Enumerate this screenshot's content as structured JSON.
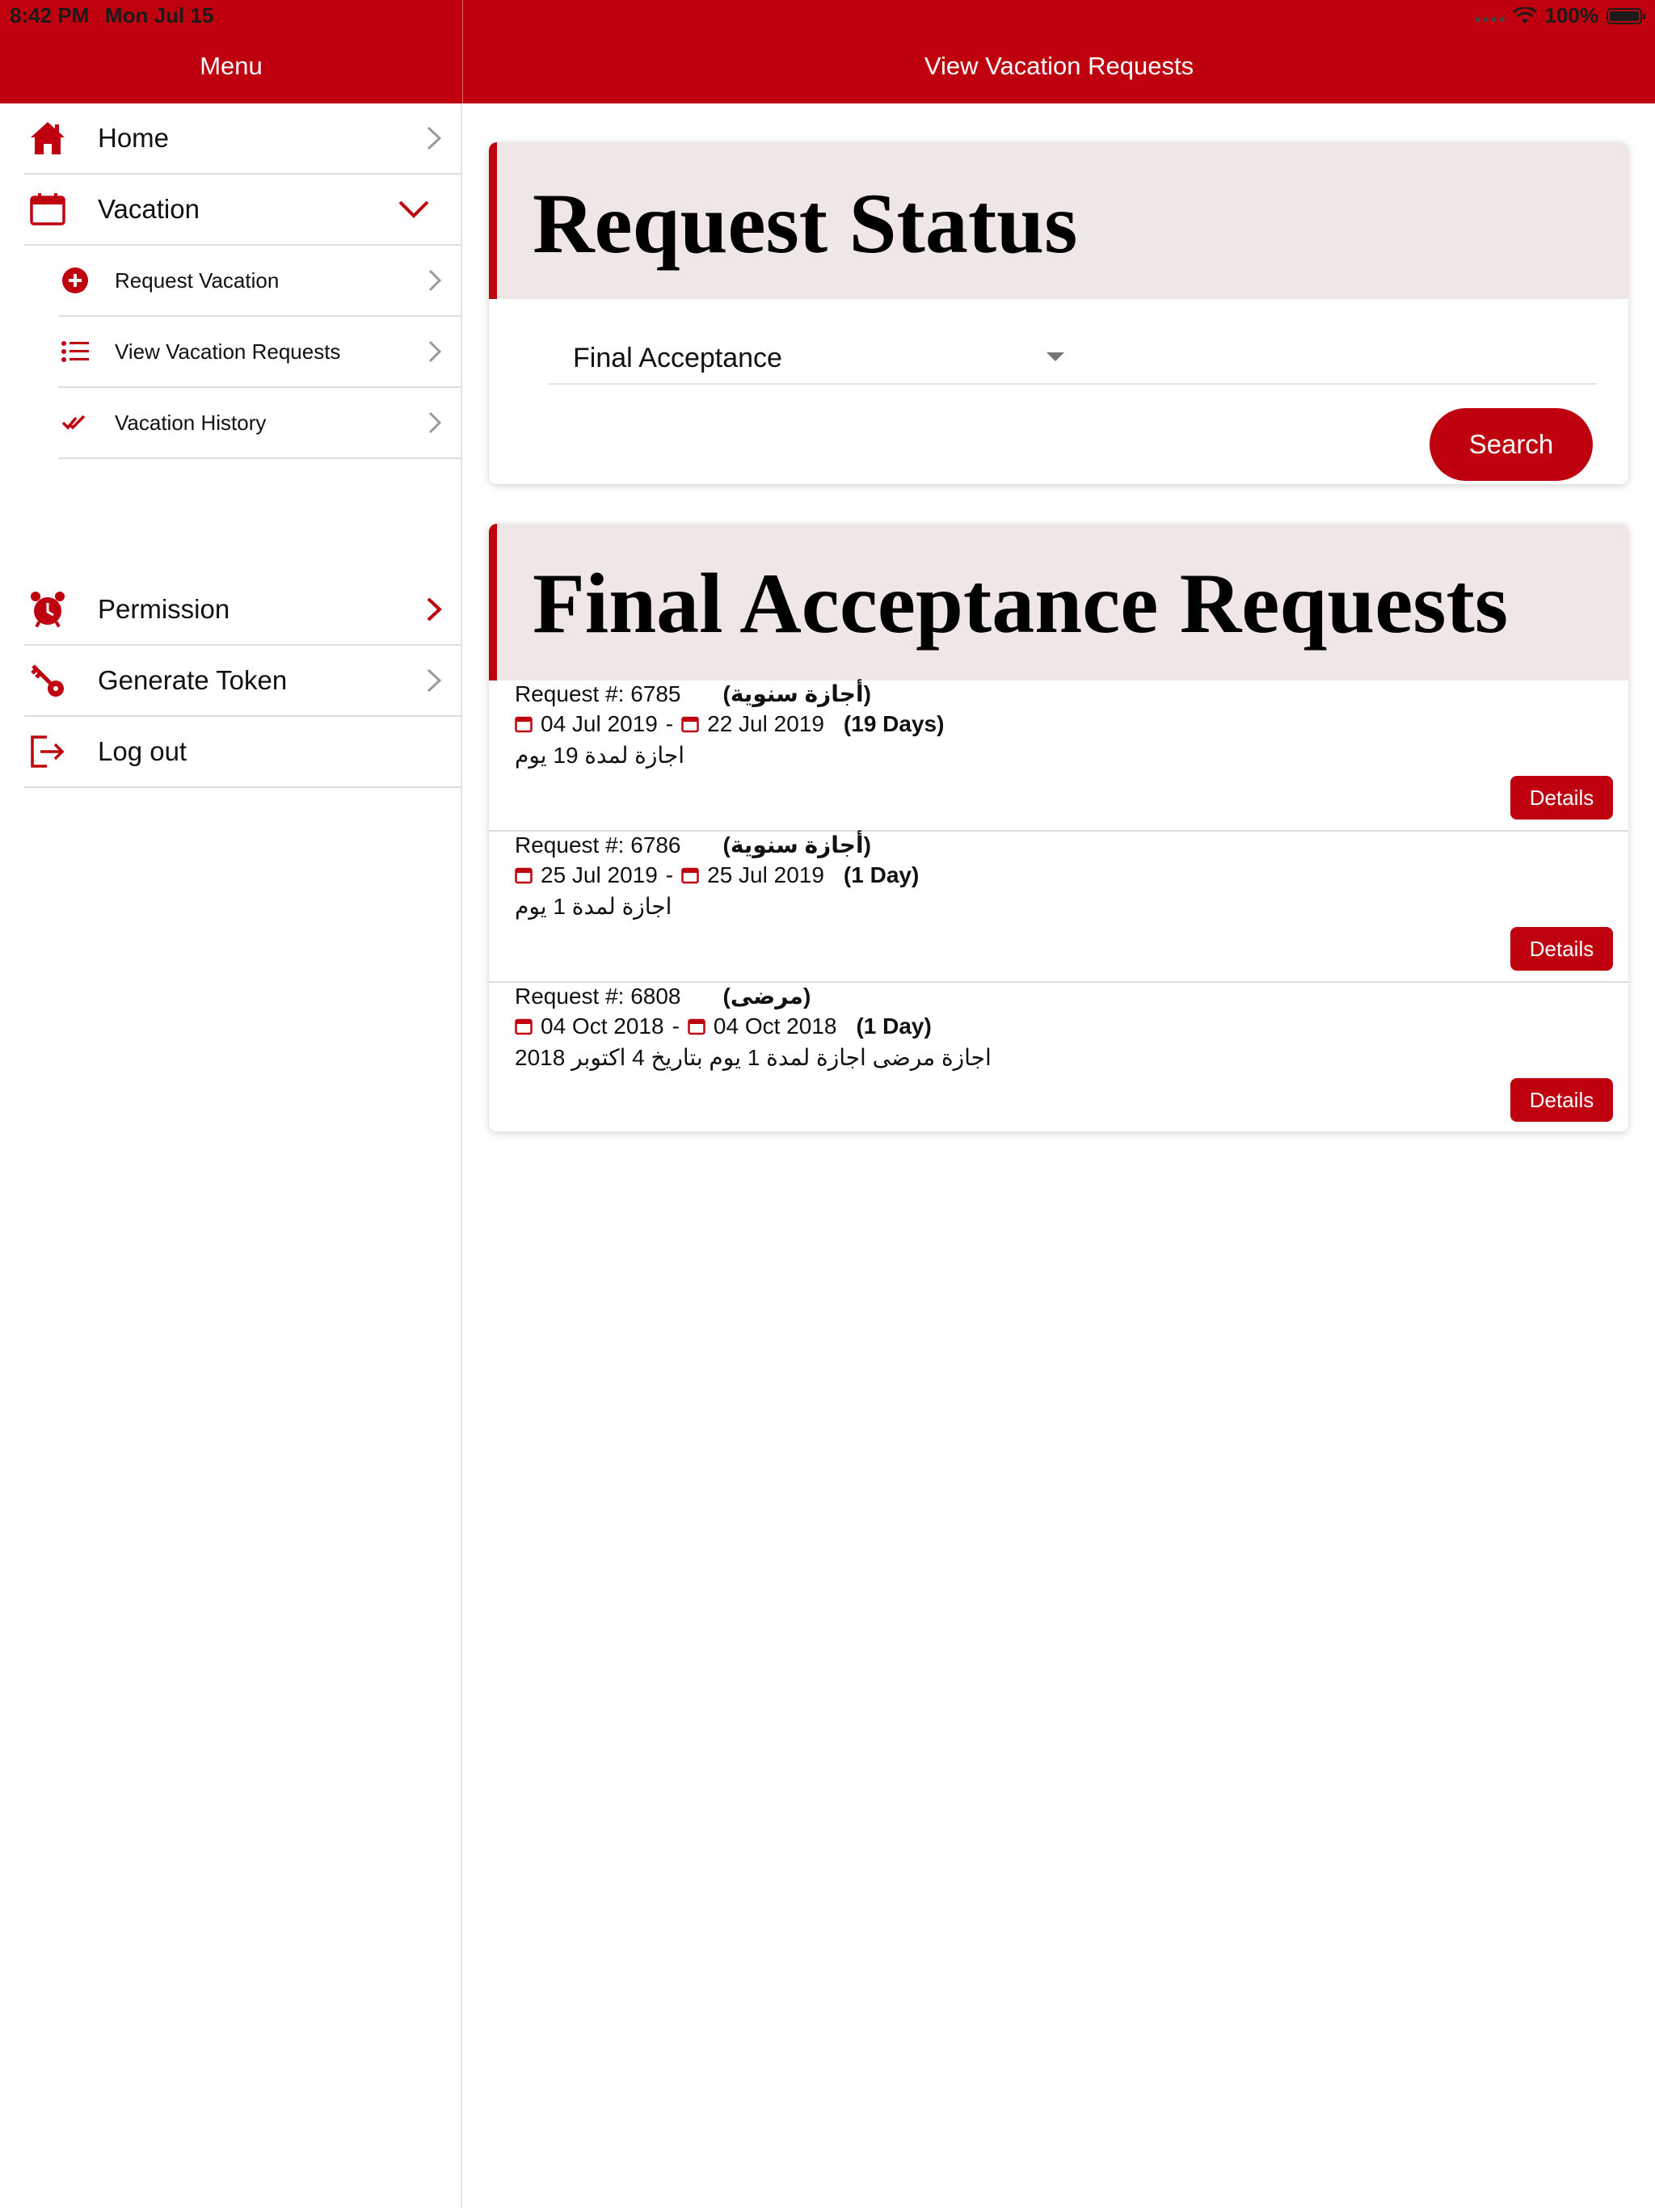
{
  "status_bar": {
    "time": "8:42 PM",
    "date": "Mon Jul 15",
    "battery": "100%"
  },
  "header": {
    "menu_title": "Menu",
    "page_title": "View Vacation Requests"
  },
  "colors": {
    "accent": "#bf000e",
    "card_header_bg": "#efe7e6"
  },
  "sidebar": {
    "items": [
      {
        "label": "Home",
        "icon": "home-icon"
      },
      {
        "label": "Vacation",
        "icon": "calendar-icon",
        "expanded": true,
        "children": [
          {
            "label": "Request Vacation",
            "icon": "plus-circle-icon"
          },
          {
            "label": "View Vacation Requests",
            "icon": "list-icon"
          },
          {
            "label": "Vacation History",
            "icon": "double-check-icon"
          }
        ]
      },
      {
        "label": "Permission",
        "icon": "alarm-clock-icon"
      },
      {
        "label": "Generate Token",
        "icon": "key-icon"
      },
      {
        "label": "Log out",
        "icon": "logout-icon"
      }
    ]
  },
  "status_card": {
    "title": "Request Status",
    "selected_status": "Final Acceptance",
    "search_label": "Search"
  },
  "requests_card": {
    "title": "Final Acceptance Requests",
    "details_label": "Details",
    "requests": [
      {
        "number": "Request #: 6785",
        "type": "(أجازة سنوية)",
        "start": "04 Jul 2019",
        "end": "22 Jul 2019",
        "duration": "(19 Days)",
        "note": "اجازة لمدة 19 يوم"
      },
      {
        "number": "Request #: 6786",
        "type": "(أجازة سنوية)",
        "start": "25 Jul 2019",
        "end": "25 Jul 2019",
        "duration": "(1 Day)",
        "note": "اجازة لمدة 1 يوم"
      },
      {
        "number": "Request #: 6808",
        "type": "(مرضى)",
        "start": "04 Oct 2018",
        "end": "04 Oct 2018",
        "duration": "(1 Day)",
        "note": "اجازة مرضى اجازة لمدة 1 يوم بتاريخ 4 اكتوبر 2018"
      }
    ]
  }
}
